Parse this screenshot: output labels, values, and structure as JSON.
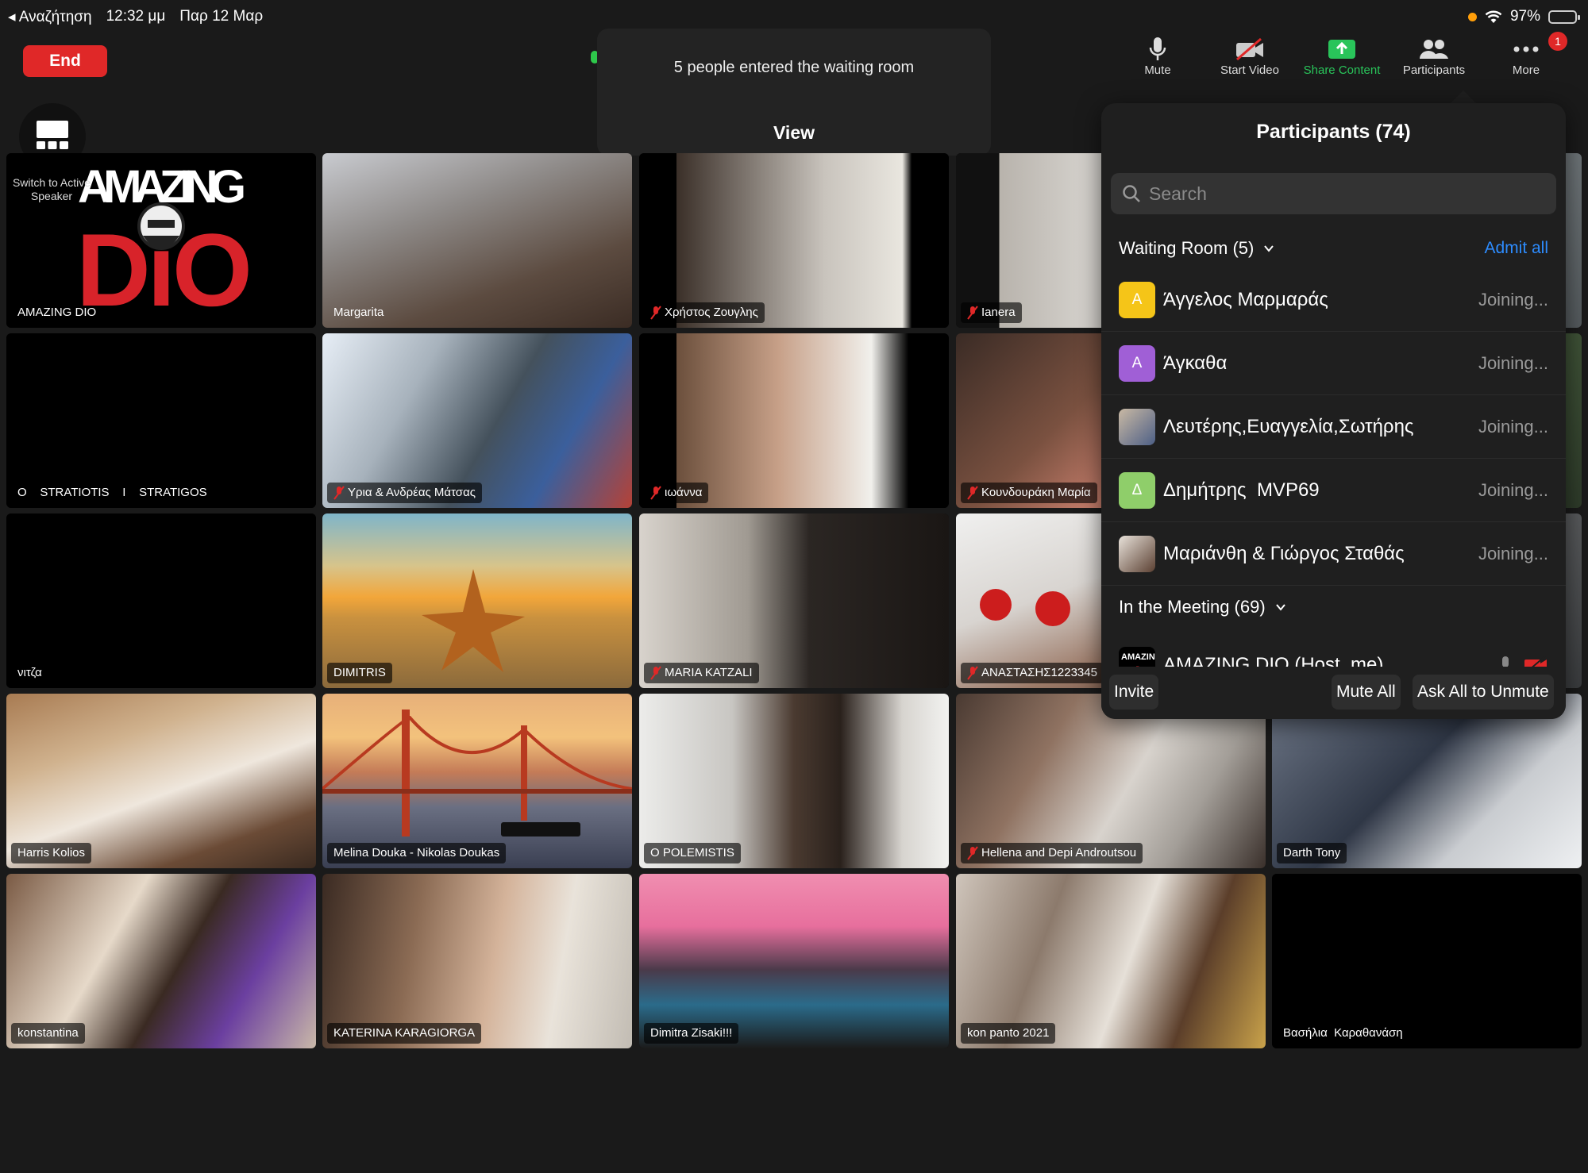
{
  "status_bar": {
    "back_label": "◂ Αναζήτηση",
    "time": "12:32 μμ",
    "date": "Παρ 12 Μαρ",
    "battery": "97%"
  },
  "top_bar": {
    "end_label": "End",
    "toolbar": [
      {
        "label": "Mute",
        "icon": "microphone-icon"
      },
      {
        "label": "Start Video",
        "icon": "video-off-icon"
      },
      {
        "label": "Share Content",
        "icon": "share-screen-icon"
      },
      {
        "label": "Participants",
        "icon": "participants-icon"
      },
      {
        "label": "More",
        "icon": "more-dots-icon",
        "badge": "1"
      }
    ]
  },
  "toast": {
    "message": "5 people entered the waiting room",
    "action": "View"
  },
  "switch_view": {
    "label": "Switch to Active Speaker"
  },
  "video_tiles": [
    {
      "name": "AMAZING DIO",
      "muted": false
    },
    {
      "name": "Margarita",
      "muted": false
    },
    {
      "name": "Χρήστος Ζουγλης",
      "muted": true
    },
    {
      "name": "Ianera",
      "muted": true
    },
    {
      "name": "O    STRATIOTIS    I    STRATIGOS",
      "muted": false
    },
    {
      "name": "Υρια & Ανδρέας Μάτσας",
      "muted": true
    },
    {
      "name": "ιωάννα",
      "muted": true
    },
    {
      "name": "Κουνδουράκη Μαρία",
      "muted": true
    },
    {
      "name": "νιτζα",
      "muted": false
    },
    {
      "name": "DIMITRIS",
      "muted": false
    },
    {
      "name": "MARIA KATZALI",
      "muted": true
    },
    {
      "name": "ΑΝΑΣΤΑΣΗΣ1223345",
      "muted": true
    },
    {
      "name": "Harris Kolios",
      "muted": false
    },
    {
      "name": "Melina Douka - Nikolas Doukas",
      "muted": false
    },
    {
      "name": "O POLEMISTIS",
      "muted": false
    },
    {
      "name": "Hellena and Depi Androutsou",
      "muted": true
    },
    {
      "name": "Darth Tony",
      "muted": false
    },
    {
      "name": "konstantina",
      "muted": false
    },
    {
      "name": "KATERINA KARAGIORGA",
      "muted": false
    },
    {
      "name": "Dimitra Zisaki!!!",
      "muted": false
    },
    {
      "name": "kon panto 2021",
      "muted": false
    },
    {
      "name": "Βασήλια  Καραθανάση",
      "muted": false
    }
  ],
  "participants_panel": {
    "title": "Participants (74)",
    "search_placeholder": "Search",
    "waiting_room": {
      "header": "Waiting Room (5)",
      "admit_all": "Admit all",
      "people": [
        {
          "initial": "Α",
          "name": "Άγγελος Μαρμαράς",
          "status": "Joining...",
          "avatar_color": "#f5c518"
        },
        {
          "initial": "Α",
          "name": "Άγκαθα",
          "status": "Joining...",
          "avatar_color": "#a05fd6"
        },
        {
          "initial": "",
          "name": "Λευτέρης,Ευαγγελία,Σωτήρης",
          "status": "Joining...",
          "avatar_color": "#6a7fa6"
        },
        {
          "initial": "Δ",
          "name": "Δημήτρης  MVP69",
          "status": "Joining...",
          "avatar_color": "#8fce6a"
        },
        {
          "initial": "",
          "name": "Μαριάνθη & Γιώργος Σταθάς",
          "status": "Joining...",
          "avatar_color": "#8a6e5c"
        }
      ]
    },
    "in_meeting": {
      "header": "In the Meeting (69)",
      "first": "AMAZING DIO (Host, me)"
    },
    "footer": {
      "invite": "Invite",
      "mute_all": "Mute All",
      "ask_all": "Ask All to Unmute"
    }
  },
  "colors": {
    "end_red": "#e02828",
    "share_green": "#29c45a",
    "admit_blue": "#2d8cff"
  }
}
